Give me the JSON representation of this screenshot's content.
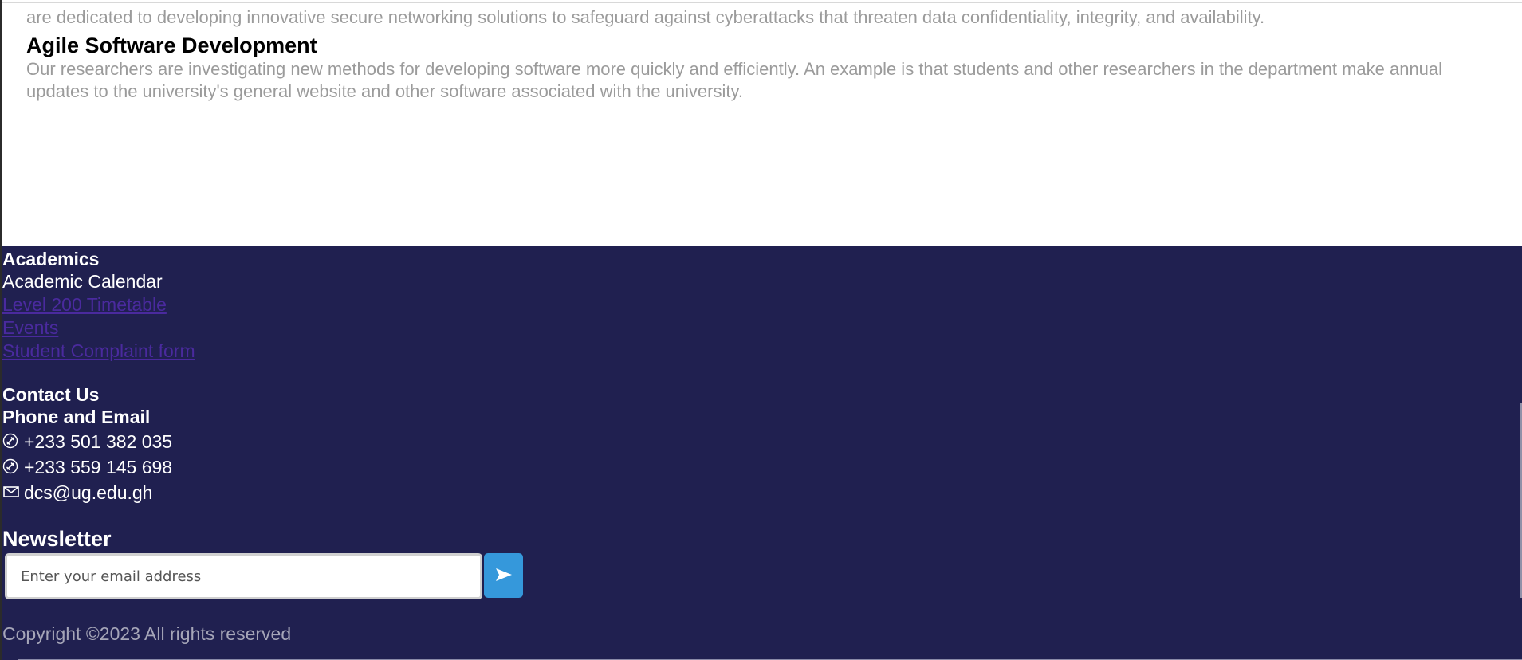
{
  "research": {
    "truncated_text": "are dedicated to developing innovative secure networking solutions to safeguard against cyberattacks that threaten data confidentiality, integrity, and availability.",
    "title": "Agile Software Development",
    "description": "Our researchers are investigating new methods for developing software more quickly and efficiently. An example is that students and other researchers in the department make annual updates to the university's general website and other software associated with the university."
  },
  "footer": {
    "academics": {
      "heading": "Academics",
      "calendar_label": "Academic Calendar",
      "links": [
        "Level 200 Timetable",
        "Events",
        "Student Complaint form"
      ]
    },
    "contact": {
      "heading": "Contact Us",
      "subheading": "Phone and Email",
      "phone1": "+233 501 382 035",
      "phone2": "+233 559 145 698",
      "email": "dcs@ug.edu.gh"
    },
    "newsletter": {
      "heading": "Newsletter",
      "placeholder": "Enter your email address"
    },
    "copyright": "Copyright ©2023 All rights reserved"
  },
  "colors": {
    "footer_bg": "#202050",
    "link": "#4a2a9e",
    "send_button": "#3598db",
    "muted_text": "#9b9b9b"
  },
  "icons": {
    "phone": "phone-icon",
    "email": "envelope-icon",
    "send": "send-arrow-icon"
  }
}
